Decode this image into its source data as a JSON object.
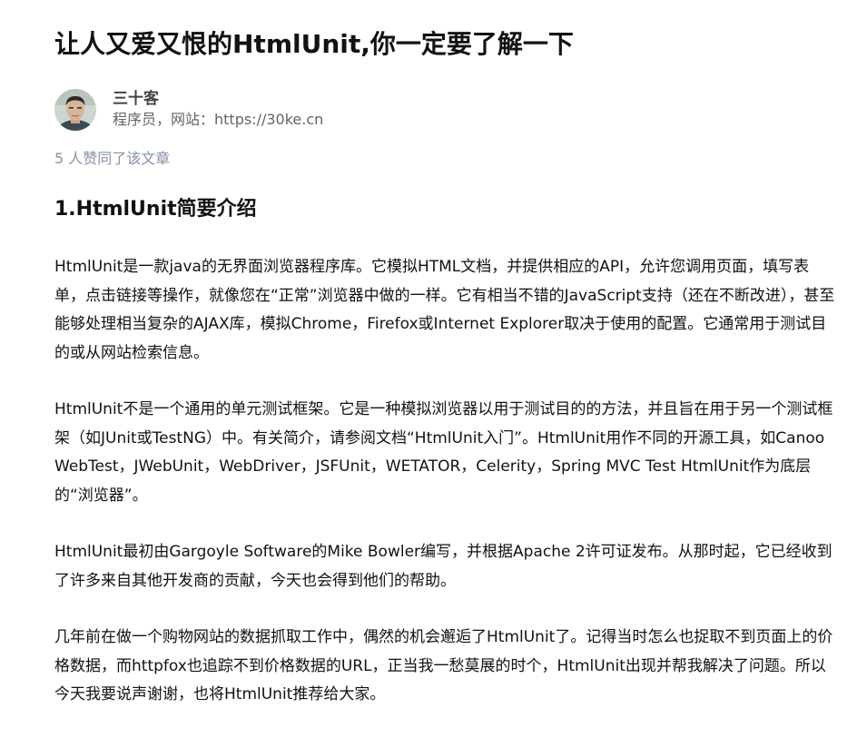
{
  "article": {
    "title": "让人又爱又恨的HtmlUnit,你一定要了解一下",
    "author": {
      "name": "三十客",
      "bio": "程序员，网站：https://30ke.cn"
    },
    "likes_text": "5 人赞同了该文章",
    "section_heading": "1.HtmlUnit简要介绍",
    "paragraphs": [
      "HtmlUnit是一款java的无界面浏览器程序库。它模拟HTML文档，并提供相应的API，允许您调用页面，填写表单，点击链接等操作，就像您在“正常”浏览器中做的一样。它有相当不错的JavaScript支持（还在不断改进），甚至能够处理相当复杂的AJAX库，模拟Chrome，Firefox或Internet Explorer取决于使用的配置。它通常用于测试目的或从网站检索信息。",
      "HtmlUnit不是一个通用的单元测试框架。它是一种模拟浏览器以用于测试目的的方法，并且旨在用于另一个测试框架（如JUnit或TestNG）中。有关简介，请参阅文档“HtmlUnit入门”。HtmlUnit用作不同的开源工具，如Canoo WebTest，JWebUnit，WebDriver，JSFUnit，WETATOR，Celerity，Spring MVC Test HtmlUnit作为底层的“浏览器”。",
      "HtmlUnit最初由Gargoyle Software的Mike Bowler编写，并根据Apache 2许可证发布。从那时起，它已经收到了许多来自其他开发商的贡献，今天也会得到他们的帮助。",
      "几年前在做一个购物网站的数据抓取工作中，偶然的机会邂逅了HtmlUnit了。记得当时怎么也捉取不到页面上的价格数据，而httpfox也追踪不到价格数据的URL，正当我一愁莫展的时个，HtmlUnit出现并帮我解决了问题。所以今天我要说声谢谢，也将HtmlUnit推荐给大家。"
    ]
  }
}
